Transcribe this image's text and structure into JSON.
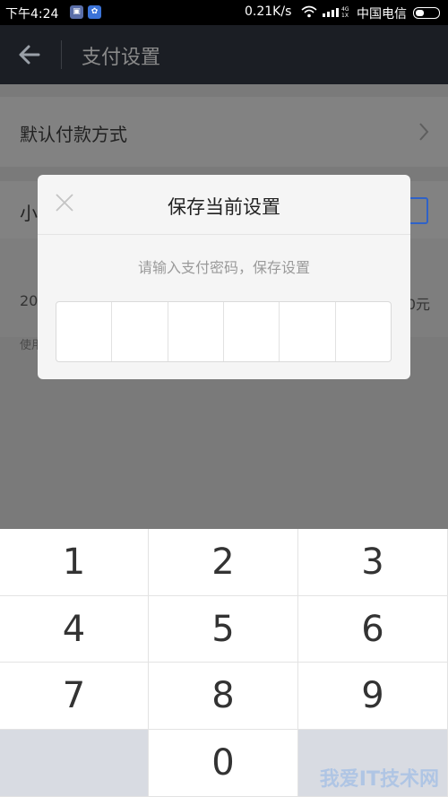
{
  "status_bar": {
    "time": "下午4:24",
    "net_speed": "0.21K/s",
    "network_type": "4G\n1X",
    "carrier": "中国电信",
    "icons": [
      "sim-icon",
      "settings-gear-icon",
      "wifi-icon",
      "signal-icon",
      "battery-icon"
    ]
  },
  "header": {
    "title": "支付设置",
    "back_icon": "back-arrow-icon"
  },
  "settings": {
    "default_payment_label": "默认付款方式",
    "small_free_label_partial": "小",
    "amount_left_partial": "20",
    "amount_right_partial": "0元",
    "footnote_partial": "使用"
  },
  "dialog": {
    "title": "保存当前设置",
    "hint": "请输入支付密码，保存设置",
    "pin_length": 6
  },
  "keypad": {
    "keys": [
      "1",
      "2",
      "3",
      "4",
      "5",
      "6",
      "7",
      "8",
      "9",
      "",
      "0",
      ""
    ]
  },
  "watermark": {
    "text": "我爱IT技术网"
  }
}
